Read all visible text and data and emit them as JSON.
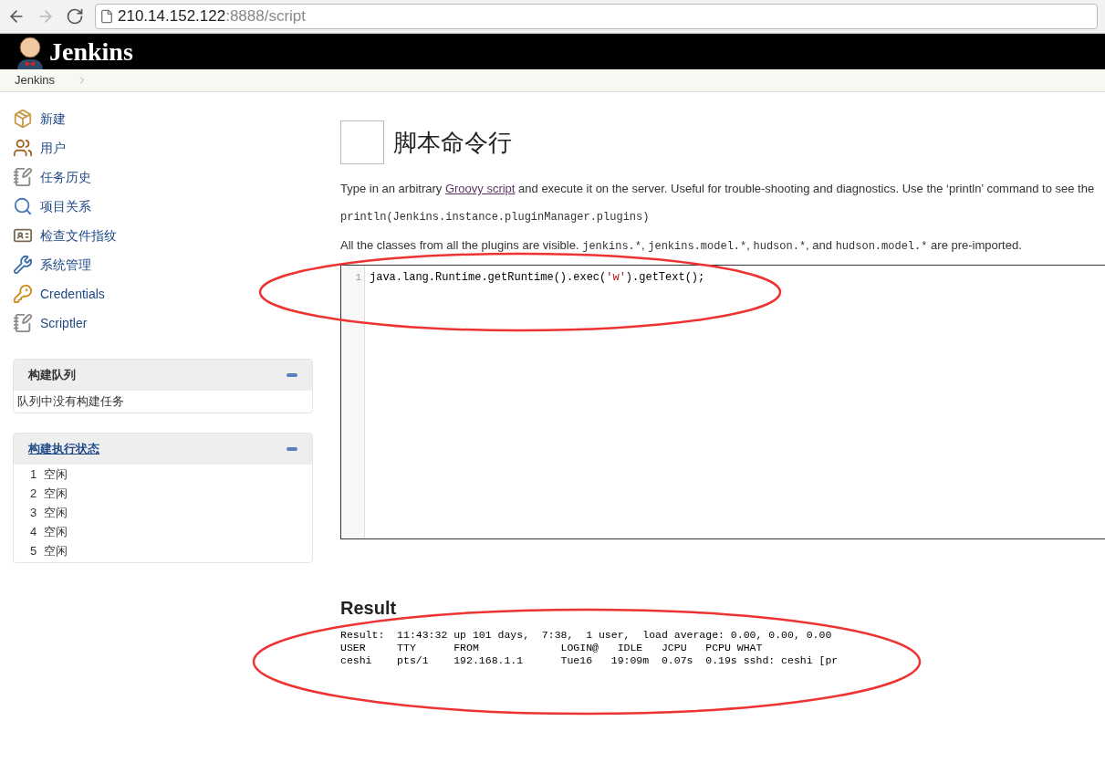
{
  "browser": {
    "url_host": "210.14.152.122",
    "url_path": ":8888/script"
  },
  "header": {
    "logo_text": "Jenkins"
  },
  "breadcrumb": [
    "Jenkins"
  ],
  "sidebar": {
    "tasks": [
      {
        "label": "新建",
        "kind": "new"
      },
      {
        "label": "用户",
        "kind": "users"
      },
      {
        "label": "任务历史",
        "kind": "history"
      },
      {
        "label": "项目关系",
        "kind": "search"
      },
      {
        "label": "检查文件指纹",
        "kind": "fingerprint"
      },
      {
        "label": "系统管理",
        "kind": "manage"
      },
      {
        "label": "Credentials",
        "kind": "credentials"
      },
      {
        "label": "Scriptler",
        "kind": "history"
      }
    ],
    "panels": [
      {
        "title": "构建队列",
        "link": false,
        "empty_text": "队列中没有构建任务"
      },
      {
        "title": "构建执行状态",
        "link": true,
        "rows": [
          {
            "number": "1",
            "status": "空闲"
          },
          {
            "number": "2",
            "status": "空闲"
          },
          {
            "number": "3",
            "status": "空闲"
          },
          {
            "number": "4",
            "status": "空闲"
          },
          {
            "number": "5",
            "status": "空闲"
          }
        ]
      }
    ]
  },
  "main": {
    "title": "脚本命令行",
    "intro": [
      {
        "kind": "text",
        "text": "Type in an arbitrary "
      },
      {
        "kind": "link",
        "text": "Groovy script"
      },
      {
        "kind": "text",
        "text": " and execute it on the server. Useful for trouble-shooting and diagnostics. Use the ‘println’ command to see the"
      }
    ],
    "example": "println(Jenkins.instance.pluginManager.plugins)",
    "imports": [
      {
        "kind": "text",
        "text": "All the classes from all the plugins are visible. "
      },
      {
        "kind": "code",
        "text": "jenkins.*"
      },
      {
        "kind": "text",
        "text": ", "
      },
      {
        "kind": "code",
        "text": "jenkins.model.*"
      },
      {
        "kind": "text",
        "text": ", "
      },
      {
        "kind": "code",
        "text": "hudson.*"
      },
      {
        "kind": "text",
        "text": ", and "
      },
      {
        "kind": "code",
        "text": "hudson.model.*"
      },
      {
        "kind": "text",
        "text": " are pre-imported."
      }
    ],
    "editor": {
      "lines": [
        {
          "number": "1",
          "tokens": [
            {
              "kind": "plain",
              "text": "java.lang.Runtime.getRuntime().exec("
            },
            {
              "kind": "string",
              "text": "'w'"
            },
            {
              "kind": "plain",
              "text": ").getText();"
            }
          ]
        }
      ]
    },
    "result_title": "Result",
    "result_lines": [
      "Result:  11:43:32 up 101 days,  7:38,  1 user,  load average: 0.00, 0.00, 0.00",
      "USER     TTY      FROM             LOGIN@   IDLE   JCPU   PCPU WHAT",
      "ceshi    pts/1    192.168.1.1      Tue16   19:09m  0.07s  0.19s sshd: ceshi [pr"
    ]
  }
}
